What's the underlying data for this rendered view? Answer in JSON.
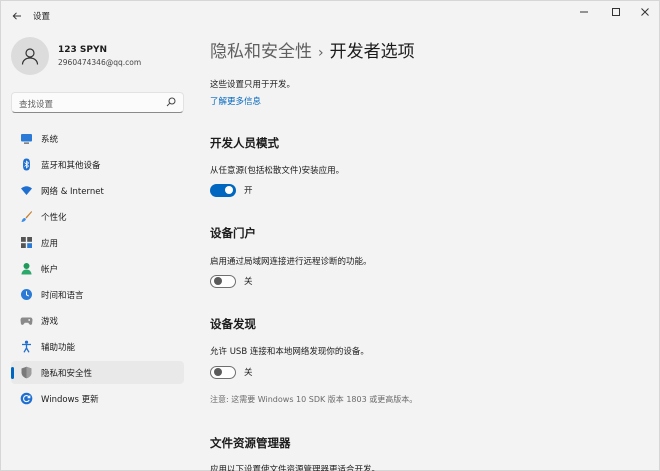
{
  "window": {
    "title": "设置",
    "controls": [
      "minimize-icon",
      "maximize-icon",
      "close-icon"
    ]
  },
  "profile": {
    "name": "123 SPYN",
    "email": "2960474346@qq.com"
  },
  "search": {
    "placeholder": "查找设置"
  },
  "sidebar": {
    "items": [
      {
        "label": "系统",
        "icon": "monitor-icon"
      },
      {
        "label": "蓝牙和其他设备",
        "icon": "bluetooth-icon"
      },
      {
        "label": "网络 & Internet",
        "icon": "wifi-icon"
      },
      {
        "label": "个性化",
        "icon": "brush-icon"
      },
      {
        "label": "应用",
        "icon": "apps-icon"
      },
      {
        "label": "帐户",
        "icon": "account-icon"
      },
      {
        "label": "时间和语言",
        "icon": "globe-clock-icon"
      },
      {
        "label": "游戏",
        "icon": "gamepad-icon"
      },
      {
        "label": "辅助功能",
        "icon": "accessibility-icon"
      },
      {
        "label": "隐私和安全性",
        "icon": "shield-icon",
        "active": true
      },
      {
        "label": "Windows 更新",
        "icon": "update-icon"
      }
    ]
  },
  "main": {
    "breadcrumb_parent": "隐私和安全性",
    "breadcrumb_separator": "›",
    "breadcrumb_current": "开发者选项",
    "intro": "这些设置只用于开发。",
    "learn_more": "了解更多信息",
    "sections": [
      {
        "title": "开发人员模式",
        "desc": "从任意源(包括松散文件)安装应用。",
        "toggle_on": true,
        "toggle_label": "开"
      },
      {
        "title": "设备门户",
        "desc": "启用通过局域网连接进行远程诊断的功能。",
        "toggle_on": false,
        "toggle_label": "关"
      },
      {
        "title": "设备发现",
        "desc": "允许 USB 连接和本地网络发现你的设备。",
        "toggle_on": false,
        "toggle_label": "关"
      },
      {
        "title": "文件资源管理器",
        "desc": "应用以下设置使文件资源管理器更适合开发。"
      }
    ],
    "note": "注意: 这需要 Windows 10 SDK 版本 1803 或更高版本。"
  },
  "colors": {
    "accent": "#0067c0",
    "background": "#f3f3f3"
  }
}
